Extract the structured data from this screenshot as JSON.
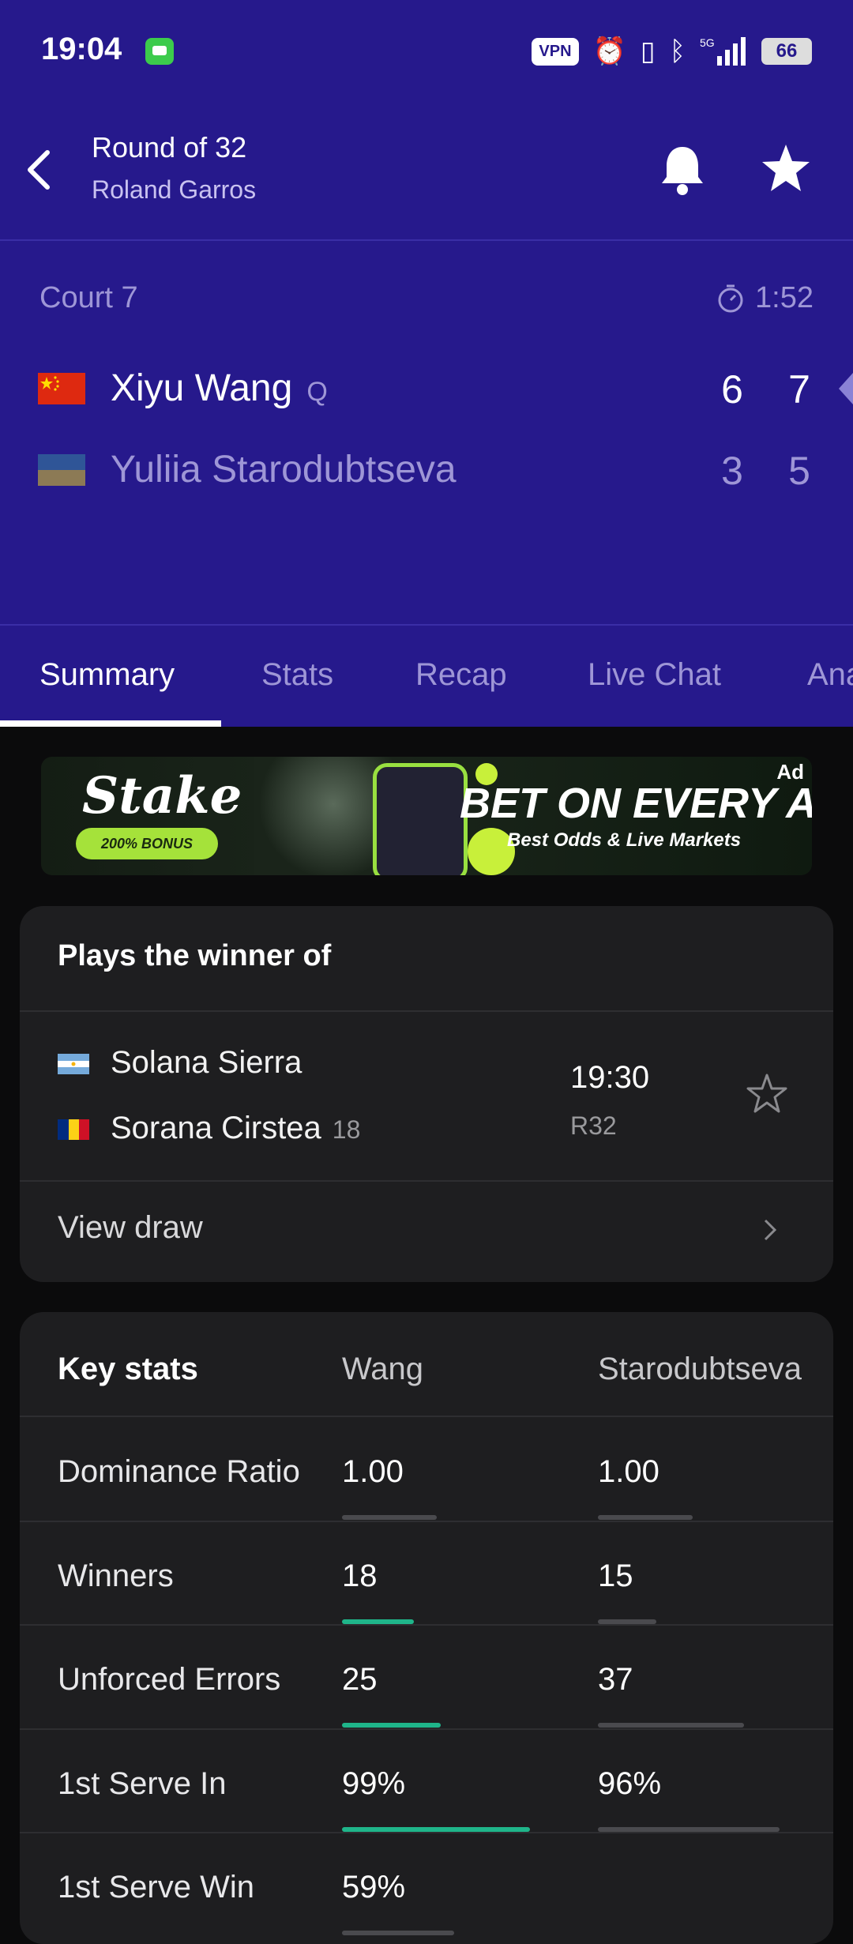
{
  "status_bar": {
    "time": "19:04",
    "vpn": "VPN",
    "signal": "5G",
    "battery": "66"
  },
  "header": {
    "title": "Round of 32",
    "subtitle": "Roland Garros"
  },
  "match": {
    "court": "Court 7",
    "duration": "1:52",
    "players": [
      {
        "name": "Xiyu Wang",
        "seed": "Q",
        "sets": [
          "6",
          "7"
        ],
        "flag": "china",
        "serving": true
      },
      {
        "name": "Yuliia Starodubtseva",
        "seed": "",
        "sets": [
          "3",
          "5"
        ],
        "flag": "ukraine",
        "serving": false
      }
    ]
  },
  "tabs": [
    "Summary",
    "Stats",
    "Recap",
    "Live Chat",
    "Ana"
  ],
  "active_tab": "Summary",
  "ad": {
    "brand": "Stake",
    "bonus": "200% BONUS",
    "headline": "BET ON EVERY ACE.",
    "subline": "Best Odds & Live Markets",
    "tag": "Ad"
  },
  "next_match": {
    "title": "Plays the winner of",
    "players": [
      {
        "name": "Solana Sierra",
        "seed": "",
        "flag": "argentina"
      },
      {
        "name": "Sorana Cirstea",
        "seed": "18",
        "flag": "romania"
      }
    ],
    "time": "19:30",
    "round": "R32",
    "view_draw": "View draw"
  },
  "key_stats": {
    "title": "Key stats",
    "col1": "Wang",
    "col2": "Starodubtseva",
    "rows": [
      {
        "label": "Dominance Ratio",
        "v1": "1.00",
        "v2": "1.00",
        "b1": 0.5,
        "b2": 0.5,
        "w1": false,
        "w2": false
      },
      {
        "label": "Winners",
        "v1": "18",
        "v2": "15",
        "b1": 0.38,
        "b2": 0.31,
        "w1": true,
        "w2": false
      },
      {
        "label": "Unforced Errors",
        "v1": "25",
        "v2": "37",
        "b1": 0.52,
        "b2": 0.77,
        "w1": true,
        "w2": false
      },
      {
        "label": "1st Serve In",
        "v1": "99%",
        "v2": "96%",
        "b1": 0.99,
        "b2": 0.96,
        "w1": true,
        "w2": false
      },
      {
        "label": "1st Serve Win",
        "v1": "59%",
        "v2": "",
        "b1": 0.59,
        "b2": 0,
        "w1": false,
        "w2": false
      }
    ]
  },
  "colors": {
    "header_bg": "#26198c",
    "accent_green": "#1fb58a",
    "bar_grey": "#4a4a4e",
    "card_bg": "#1e1e20"
  }
}
